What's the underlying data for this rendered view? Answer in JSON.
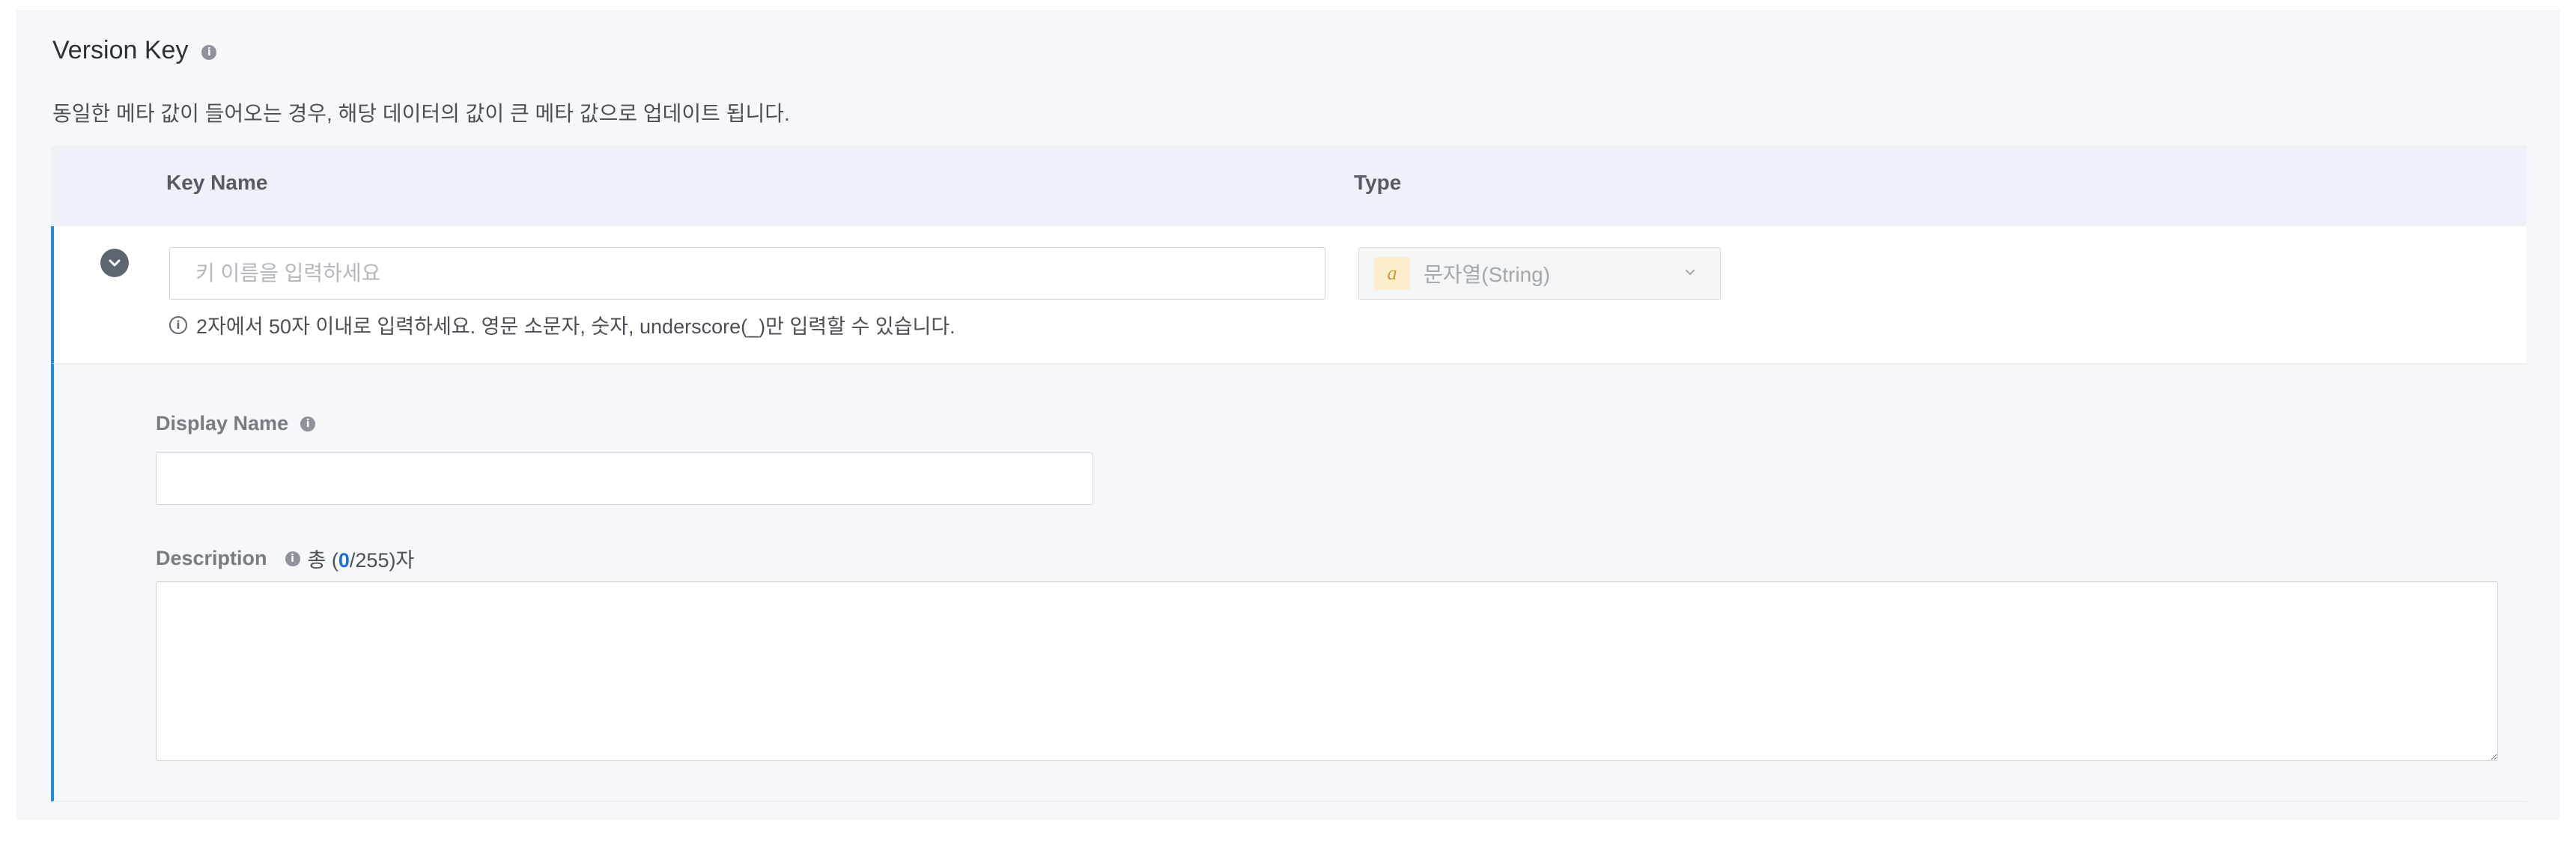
{
  "section": {
    "title": "Version Key",
    "info_icon": "info-icon",
    "description": "동일한 메타 값이 들어오는 경우, 해당 데이터의 값이 큰 메타 값으로 업데이트 됩니다."
  },
  "table": {
    "headers": {
      "key_name": "Key Name",
      "type": "Type"
    }
  },
  "row": {
    "toggle_icon": "chevron-down-icon",
    "key_input": {
      "value": "",
      "placeholder": "키 이름을 입력하세요"
    },
    "type_select": {
      "badge": "a",
      "selected": "문자열(String)",
      "chevron_icon": "chevron-down-icon"
    },
    "hint": "2자에서 50자 이내로 입력하세요. 영문 소문자, 숫자, underscore(_)만 입력할 수 있습니다."
  },
  "detail": {
    "display_name": {
      "label": "Display Name",
      "value": ""
    },
    "description": {
      "label": "Description",
      "counter_prefix": "총 (",
      "counter_value": "0",
      "counter_suffix": "/255)자",
      "value": ""
    }
  },
  "colors": {
    "accent_border": "#1f8ad6",
    "header_bg": "#eef1f8",
    "panel_bg": "#f6f7fa",
    "type_badge_bg": "#fbeccb",
    "counter_accent": "#1f6fd1"
  }
}
